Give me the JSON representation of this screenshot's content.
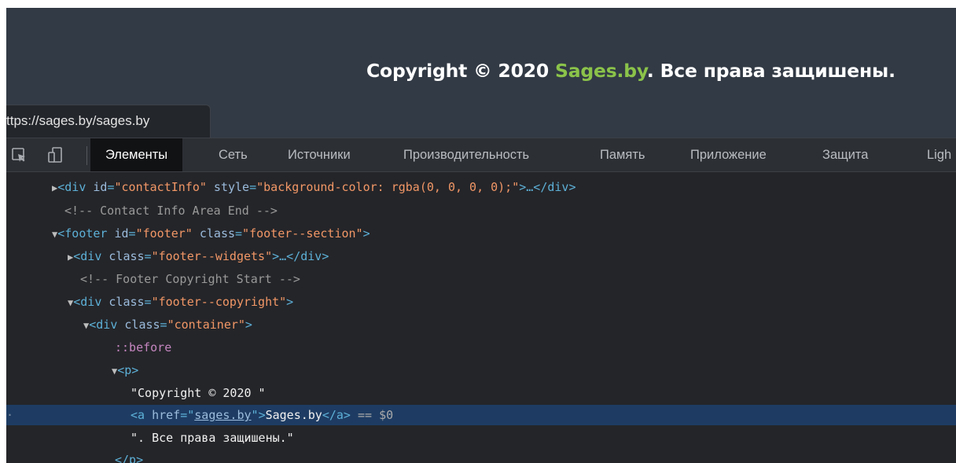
{
  "website": {
    "copyright_prefix": "Copyright © 2020 ",
    "brand": "Sages.by",
    "copyright_suffix": ". Все права защишены."
  },
  "url_tooltip": "ttps://sages.by/sages.by",
  "devtools": {
    "tabs": [
      "Элементы",
      "Сеть",
      "Источники",
      "Производительность",
      "Память",
      "Приложение",
      "Защита",
      "Ligh"
    ],
    "active_tab": "Элементы",
    "tree": {
      "l1_open": "<div ",
      "l1_attr1": "id",
      "l1_val1": "\"contactInfo\"",
      "l1_attr2": "style",
      "l1_val2": "\"background-color: rgba(0, 0, 0, 0);\"",
      "l1_close": ">…</div>",
      "l2_comment": "<!-- Contact Info Area End -->",
      "l3_open": "<footer ",
      "l3_attr1": "id",
      "l3_val1": "\"footer\"",
      "l3_attr2": "class",
      "l3_val2": "\"footer--section\"",
      "l3_close": ">",
      "l4_open": "<div ",
      "l4_attr": "class",
      "l4_val": "\"footer--widgets\"",
      "l4_close": ">…</div>",
      "l5_comment": "<!-- Footer Copyright Start -->",
      "l6_open": "<div ",
      "l6_attr": "class",
      "l6_val": "\"footer--copyright\"",
      "l6_close": ">",
      "l7_open": "<div ",
      "l7_attr": "class",
      "l7_val": "\"container\"",
      "l7_close": ">",
      "l8_pseudo": "::before",
      "l9_tag": "<p>",
      "l10_text": "\"Copyright © 2020 \"",
      "l11_open": "<a ",
      "l11_attr": "href",
      "l11_val": "sages.by",
      "l11_mid": ">",
      "l11_text": "Sages.by",
      "l11_close": "</a>",
      "l11_marker": " == $0",
      "l12_text": "\". Все права защишены.\"",
      "l13_close": "</p>"
    }
  },
  "colors": {
    "site_bg": "#323a45",
    "brand_green": "#8bc34a",
    "devtools_bg": "#242529",
    "selection": "#1e3c63"
  }
}
